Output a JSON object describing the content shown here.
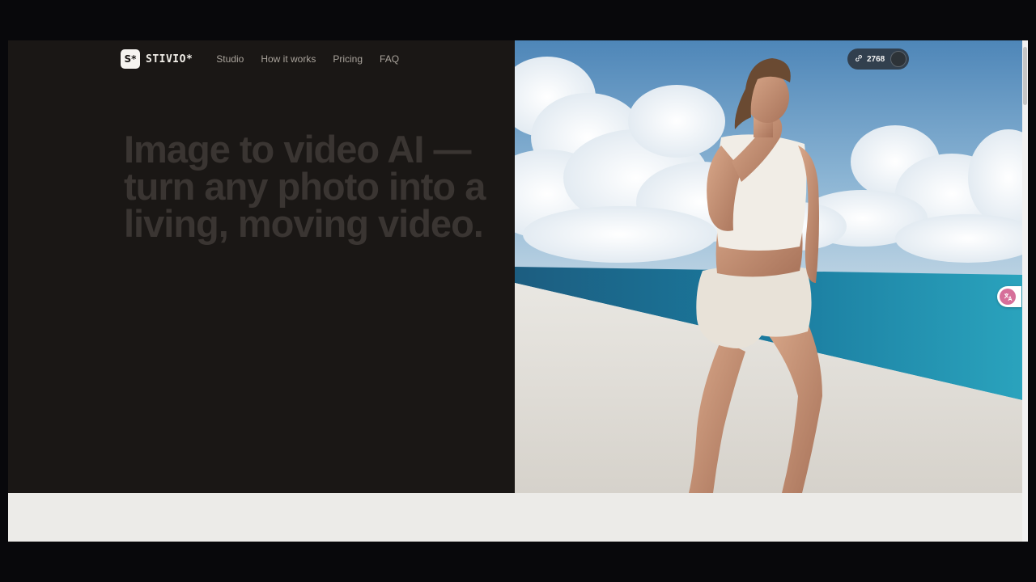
{
  "brand": {
    "logo_mark": "S*",
    "name": "STIVIO*"
  },
  "nav": {
    "links": [
      "Studio",
      "How it works",
      "Pricing",
      "FAQ"
    ]
  },
  "hero": {
    "headline_lines": [
      "Image to video AI —",
      "turn any photo into a",
      "living, moving video."
    ]
  },
  "media": {
    "counter_value": "2768",
    "counter_icon": "link-icon",
    "avatar_icon": "avatar-circle"
  },
  "colors": {
    "hero_bg": "#1a1715",
    "headline": "#3a3532",
    "nav_text": "#a9a39b",
    "page_bg": "#ecebe8",
    "letterbox": "#08080b"
  }
}
